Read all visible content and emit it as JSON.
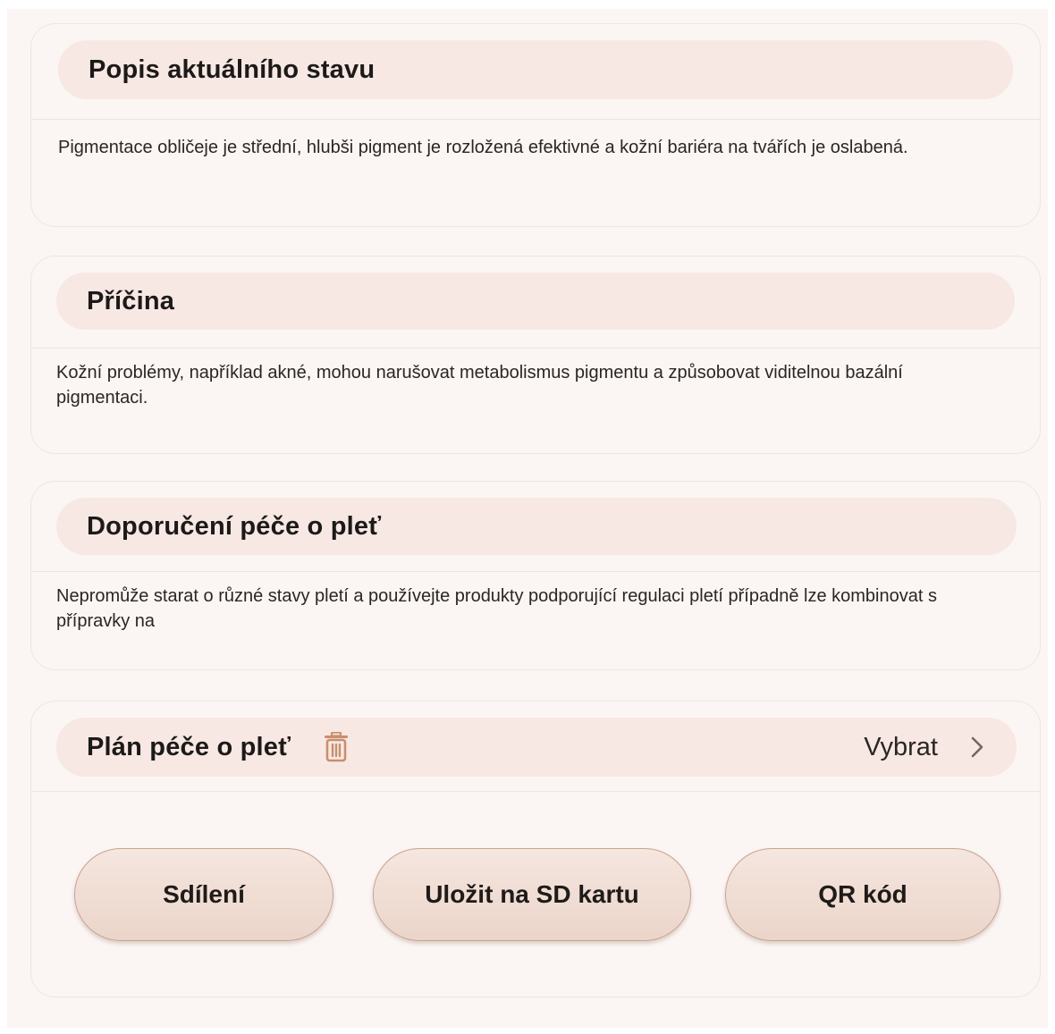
{
  "sections": [
    {
      "title": "Popis aktuálního stavu",
      "text": "Pigmentace obličeje je střední, hlubši pigment je rozložená efektivné a kožní bariéra na tvářích je oslabená."
    },
    {
      "title": "Příčina",
      "text": "Kožní problémy, například akné, mohou narušovat metabolismus pigmentu a způsobovat viditelnou bazální pigmentaci."
    },
    {
      "title": "Doporučení péče o pleť",
      "text": "Nepromůže starat o různé stavy pletí a používejte produkty podporující regulaci pletí případně lze kombinovat s přípravky na"
    }
  ],
  "plan": {
    "title": "Plán péče o pleť",
    "select_label": "Vybrat",
    "delete_icon": "trash-icon",
    "chevron_icon": "chevron-right-icon"
  },
  "buttons": {
    "share": "Sdílení",
    "save_sd": "Uložit na SD kartu",
    "qr": "QR kód"
  },
  "colors": {
    "page_background": "#fbf5f3",
    "header_pill": "#f8e8e3",
    "button_fill": "#efddd4",
    "button_border": "#c9a391",
    "icon_accent": "#c98f6e"
  }
}
